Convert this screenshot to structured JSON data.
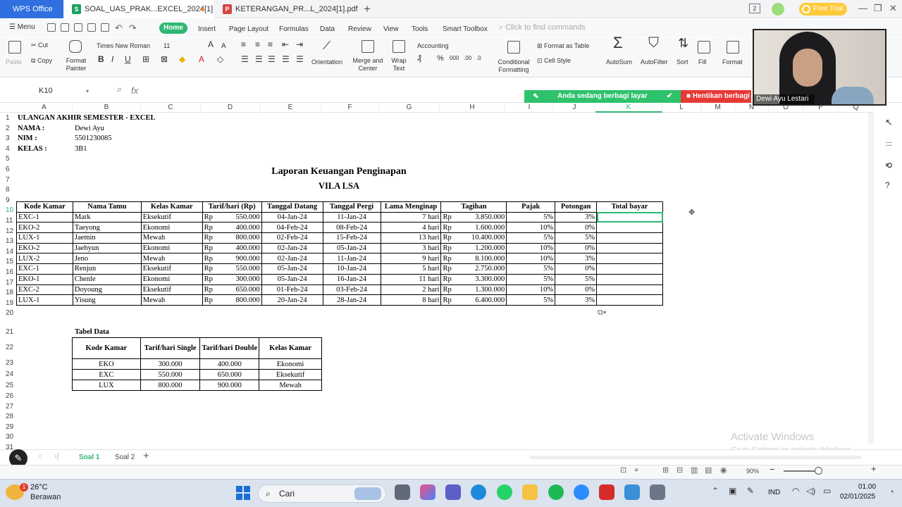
{
  "titlebar": {
    "app_tab": "WPS Office",
    "tab_excel": "SOAL_UAS_PRAK...EXCEL_2024[1]",
    "tab_pdf": "KETERANGAN_PR...L_2024[1].pdf",
    "page_count": "2",
    "free_trial": "Free Trial"
  },
  "menubar": {
    "menu": "Menu",
    "tabs": [
      "Home",
      "Insert",
      "Page Layout",
      "Formulas",
      "Data",
      "Review",
      "View",
      "Tools",
      "Smart Toolbox"
    ],
    "search_placeholder": "Click to find commands"
  },
  "ribbon": {
    "paste": "Paste",
    "cut": "Cut",
    "copy": "Copy",
    "format_painter": "Format Painter",
    "font_name": "Times New Roman",
    "font_size": "11",
    "orientation": "Orientation",
    "merge_center": "Merge and Center",
    "wrap_text": "Wrap Text",
    "number_format": "Accounting",
    "conditional_formatting": "Conditional Formatting",
    "format_as_table": "Format as Table",
    "cell_style": "Cell Style",
    "autosum": "AutoSum",
    "autofilter": "AutoFilter",
    "sort": "Sort",
    "fill": "Fill",
    "format": "Format"
  },
  "formula_bar": {
    "cell_ref": "K10",
    "fx": "fx"
  },
  "share": {
    "sharing_text": "Anda sedang berbagi layar",
    "stop_text": "Hentikan berbagi"
  },
  "webcam": {
    "name": "Dewi Ayu Lestari"
  },
  "columns": [
    "A",
    "B",
    "C",
    "D",
    "E",
    "F",
    "G",
    "H",
    "I",
    "J",
    "K",
    "L",
    "M",
    "N",
    "O",
    "P",
    "Q"
  ],
  "rows": [
    "1",
    "2",
    "3",
    "4",
    "5",
    "6",
    "7",
    "8",
    "9",
    "10",
    "11",
    "12",
    "13",
    "14",
    "15",
    "16",
    "17",
    "18",
    "19",
    "20",
    "21",
    "22",
    "23",
    "24",
    "25",
    "26",
    "27",
    "28",
    "29",
    "30",
    "31"
  ],
  "header": {
    "title": "ULANGAN AKHIR SEMESTER - EXCEL",
    "nama_label": "NAMA :",
    "nama_value": "Dewi Ayu",
    "nim_label": "NIM :",
    "nim_value": "5501230085",
    "kelas_label": "KELAS :",
    "kelas_value": "3B1",
    "report_title": "Laporan  Keuangan Penginapan",
    "report_subtitle": "VILA LSA"
  },
  "main_table": {
    "headers": [
      "Kode Kamar",
      "Nama Tamu",
      "Kelas Kamar",
      "Tarif/hari (Rp)",
      "Tanggal Datang",
      "Tanggal Pergi",
      "Lama Menginap",
      "Tagihan",
      "Pajak",
      "Potongan",
      "Total bayar"
    ],
    "currency": "Rp",
    "rows": [
      [
        "EXC-1",
        "Mark",
        "Eksekutif",
        "550.000",
        "04-Jan-24",
        "11-Jan-24",
        "7 hari",
        "3.850.000",
        "5%",
        "3%",
        ""
      ],
      [
        "EKO-2",
        "Taeyong",
        "Ekonomi",
        "400.000",
        "04-Feb-24",
        "08-Feb-24",
        "4 hari",
        "1.600.000",
        "10%",
        "0%",
        ""
      ],
      [
        "LUX-1",
        "Jaemin",
        "Mewah",
        "800.000",
        "02-Feb-24",
        "15-Feb-24",
        "13 hari",
        "10.400.000",
        "5%",
        "5%",
        ""
      ],
      [
        "EKO-2",
        "Jaehyun",
        "Ekonomi",
        "400.000",
        "02-Jan-24",
        "05-Jan-24",
        "3 hari",
        "1.200.000",
        "10%",
        "0%",
        ""
      ],
      [
        "LUX-2",
        "Jeno",
        "Mewah",
        "900.000",
        "02-Jan-24",
        "11-Jan-24",
        "9 hari",
        "8.100.000",
        "10%",
        "3%",
        ""
      ],
      [
        "EXC-1",
        "Renjun",
        "Eksekutif",
        "550.000",
        "05-Jan-24",
        "10-Jan-24",
        "5 hari",
        "2.750.000",
        "5%",
        "0%",
        ""
      ],
      [
        "EKO-1",
        "Chenle",
        "Ekonomi",
        "300.000",
        "05-Jan-24",
        "16-Jan-24",
        "11 hari",
        "3.300.000",
        "5%",
        "5%",
        ""
      ],
      [
        "EXC-2",
        "Doyoung",
        "Eksekutif",
        "650.000",
        "01-Feb-24",
        "03-Feb-24",
        "2 hari",
        "1.300.000",
        "10%",
        "0%",
        ""
      ],
      [
        "LUX-1",
        "Yisung",
        "Mewah",
        "800.000",
        "20-Jan-24",
        "28-Jan-24",
        "8 hari",
        "6.400.000",
        "5%",
        "3%",
        ""
      ]
    ]
  },
  "data_table": {
    "label": "Tabel Data",
    "headers": [
      "Kode Kamar",
      "Tarif/hari Single",
      "Tarif/hari Double",
      "Kelas Kamar"
    ],
    "rows": [
      [
        "EKO",
        "300.000",
        "400.000",
        "Ekonomi"
      ],
      [
        "EXC",
        "550.000",
        "650.000",
        "Eksekutif"
      ],
      [
        "LUX",
        "800.000",
        "900.000",
        "Mewah"
      ]
    ]
  },
  "sheets": {
    "tab1": "Soal 1",
    "tab2": "Soal 2"
  },
  "watermark": {
    "line1": "Activate Windows",
    "line2": "Go to Settings to activate Windows."
  },
  "status": {
    "zoom": "90%"
  },
  "taskbar": {
    "temp": "26°C",
    "weather": "Berawan",
    "weather_badge": "1",
    "search": "Cari",
    "lang": "IND",
    "time": "01.00",
    "date": "02/01/2025"
  },
  "colors": {
    "accent": "#2eb873",
    "wps_blue": "#2f6fe0",
    "share_green": "#2ec26b",
    "stop_red": "#e53935"
  }
}
